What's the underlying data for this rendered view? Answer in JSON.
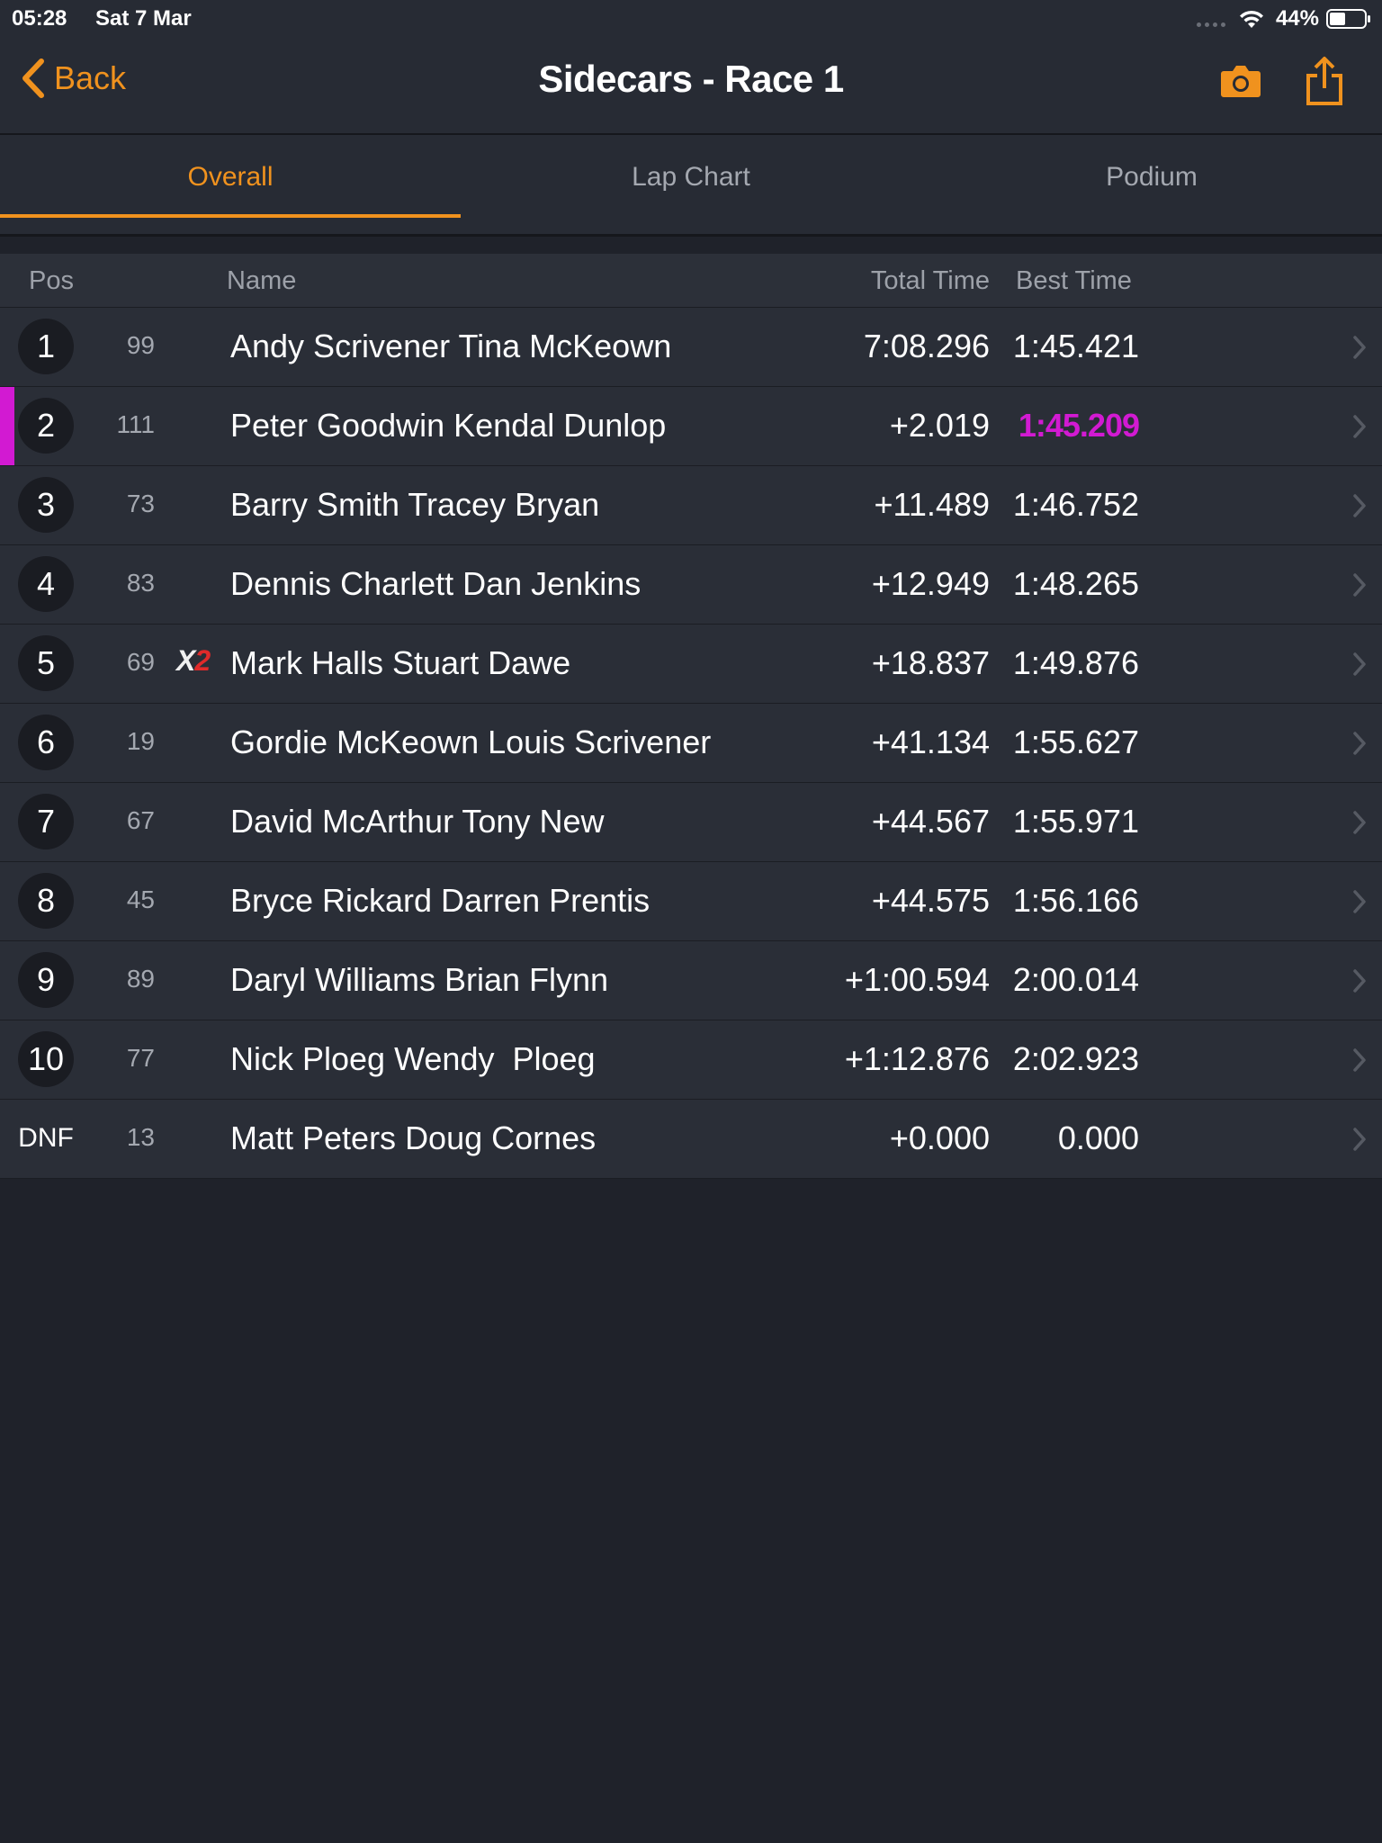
{
  "status": {
    "time": "05:28",
    "date": "Sat 7 Mar",
    "battery": "44%"
  },
  "nav": {
    "back_label": "Back",
    "title": "Sidecars - Race 1",
    "accent": "#f0921e"
  },
  "tabs": [
    {
      "label": "Overall",
      "active": true
    },
    {
      "label": "Lap Chart",
      "active": false
    },
    {
      "label": "Podium",
      "active": false
    }
  ],
  "table": {
    "headers": {
      "pos": "Pos",
      "name": "Name",
      "total": "Total Time",
      "best": "Best Time"
    },
    "fastest_color": "#d21ad2",
    "rows": [
      {
        "pos": "1",
        "number": "99",
        "name": "Andy Scrivener Tina McKeown",
        "total": "7:08.296",
        "best": "1:45.421"
      },
      {
        "pos": "2",
        "number": "111",
        "name": "Peter Goodwin Kendal Dunlop",
        "total": "+2.019",
        "best": "1:45.209",
        "fastest": true
      },
      {
        "pos": "3",
        "number": "73",
        "name": "Barry Smith Tracey Bryan",
        "total": "+11.489",
        "best": "1:46.752"
      },
      {
        "pos": "4",
        "number": "83",
        "name": "Dennis Charlett Dan Jenkins",
        "total": "+12.949",
        "best": "1:48.265"
      },
      {
        "pos": "5",
        "number": "69",
        "badge_x": "X",
        "badge_num": "2",
        "name": "Mark Halls Stuart Dawe",
        "total": "+18.837",
        "best": "1:49.876"
      },
      {
        "pos": "6",
        "number": "19",
        "name": "Gordie McKeown Louis Scrivener",
        "total": "+41.134",
        "best": "1:55.627"
      },
      {
        "pos": "7",
        "number": "67",
        "name": "David McArthur Tony New",
        "total": "+44.567",
        "best": "1:55.971"
      },
      {
        "pos": "8",
        "number": "45",
        "name": "Bryce Rickard Darren Prentis",
        "total": "+44.575",
        "best": "1:56.166"
      },
      {
        "pos": "9",
        "number": "89",
        "name": "Daryl Williams Brian Flynn",
        "total": "+1:00.594",
        "best": "2:00.014"
      },
      {
        "pos": "10",
        "number": "77",
        "name": "Nick Ploeg Wendy  Ploeg",
        "total": "+1:12.876",
        "best": "2:02.923"
      },
      {
        "pos": "DNF",
        "number": "13",
        "name": "Matt Peters Doug Cornes",
        "total": "+0.000",
        "best": "0.000"
      }
    ]
  }
}
